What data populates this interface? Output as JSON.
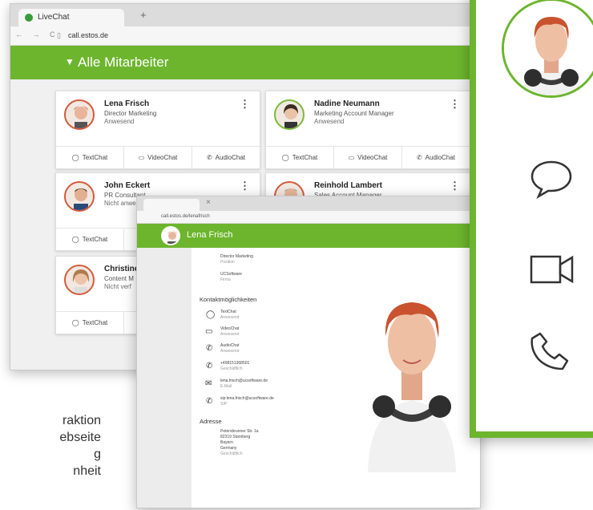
{
  "colors": {
    "brand_green": "#6cb52d",
    "avatar_border_red": "#d65a3a"
  },
  "browser": {
    "tab_title": "LiveChat",
    "new_tab_symbol": "+",
    "nav_symbols": "← → C",
    "url": "call.estos.de"
  },
  "header": {
    "title": "Alle Mitarbeiter"
  },
  "employees": [
    {
      "name": "Lena Frisch",
      "role": "Director Marketing",
      "status": "Anwesend"
    },
    {
      "name": "Nadine Neumann",
      "role": "Marketing Account Manager",
      "status": "Anwesend"
    },
    {
      "name": "John Eckert",
      "role": "PR Consultant",
      "status": "Nicht anwesend"
    },
    {
      "name": "Reinhold Lambert",
      "role": "Sales Account Manager",
      "status": ""
    },
    {
      "name": "Christine",
      "role": "Content M",
      "status": "Nicht verf"
    }
  ],
  "actions": {
    "text": "TextChat",
    "video": "VideoChat",
    "audio": "AudioChat",
    "kebab": "⋮"
  },
  "detail": {
    "name": "Lena Frisch",
    "url": "call.estos.de/lenafrisch",
    "role_label": "Director Marketing",
    "role_sub": "Position",
    "company": "UCSoftware",
    "company_sub": "Firma",
    "contacts_heading": "Kontaktmöglichkeiten",
    "contacts": [
      {
        "label": "TextChat",
        "sub": "Anwesend"
      },
      {
        "label": "VideoChat",
        "sub": "Anwesend"
      },
      {
        "label": "AudioChat",
        "sub": "Anwesend"
      },
      {
        "label": "+498151368501",
        "sub": "Geschäftlich"
      },
      {
        "label": "lena.frisch@ucsoftware.de",
        "sub": "E-Mail"
      },
      {
        "label": "sip:lena.frisch@ucsoftware.de",
        "sub": "SIP"
      }
    ],
    "address_heading": "Adresse",
    "address_lines": [
      "Petersbrunner Str. 1a",
      "82319 Starnberg",
      "Bayern",
      "Germany",
      "Geschäftlich"
    ]
  },
  "left_text": [
    "raktion",
    "ebseite",
    "g",
    "nheit"
  ]
}
